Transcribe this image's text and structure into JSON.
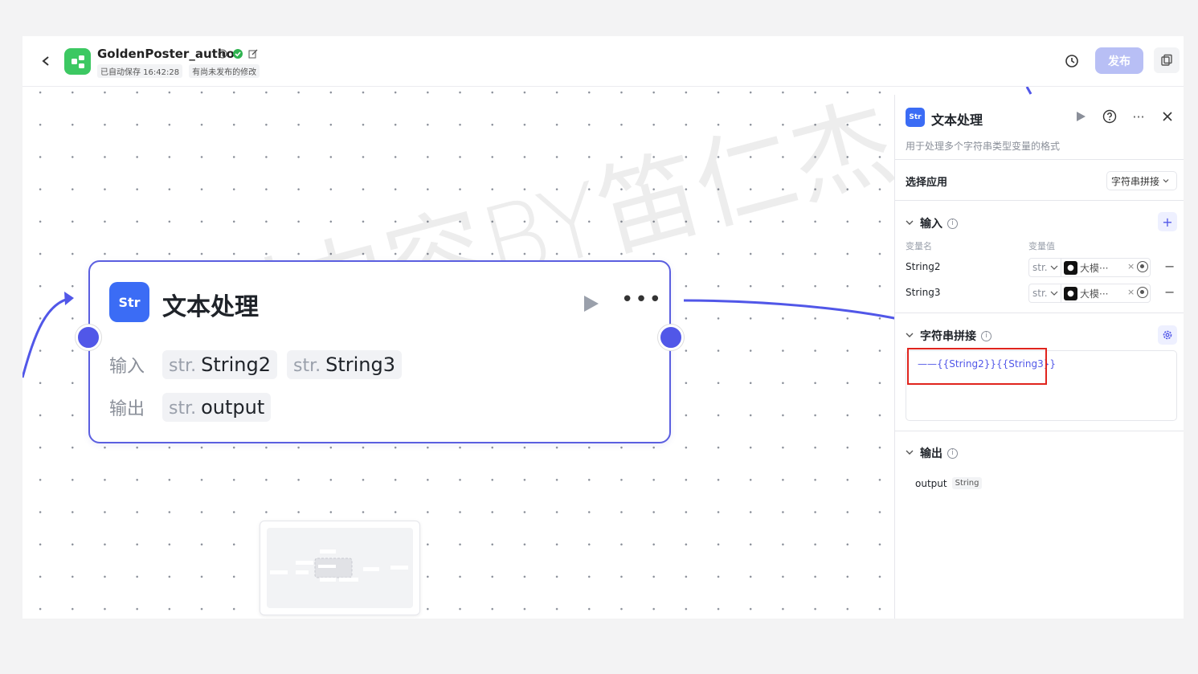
{
  "header": {
    "app_title": "GoldenPoster_author",
    "autosave": "已自动保存 16:42:28",
    "unpublished": "有尚未发布的修改",
    "publish_label": "发布",
    "colors": {
      "publish_bg": "#b8bff5",
      "app_logo": "#3cc862"
    },
    "icons": [
      "back-icon",
      "info-icon",
      "check-circle-icon",
      "edit-icon",
      "history-icon",
      "copy-icon"
    ]
  },
  "node": {
    "title": "文本处理",
    "icon_text": "Str",
    "input_label": "输入",
    "output_label": "输出",
    "type_prefix": "str.",
    "inputs": [
      "String2",
      "String3"
    ],
    "outputs": [
      "output"
    ]
  },
  "watermark": "原创内容BY笛仁杰",
  "panel": {
    "title": "文本处理",
    "icon_text": "Str",
    "description": "用于处理多个字符串类型变量的格式",
    "select_app_label": "选择应用",
    "select_app_value": "字符串拼接",
    "input_section": "输入",
    "col_var_name": "变量名",
    "col_var_value": "变量值",
    "variables": [
      {
        "name": "String2",
        "type": "str.",
        "value": "大模···"
      },
      {
        "name": "String3",
        "type": "str.",
        "value": "大模···"
      }
    ],
    "concat_section": "字符串拼接",
    "template": "——{{String2}}{{String3}}",
    "output_section": "输出",
    "output_name": "output",
    "output_type": "String"
  }
}
